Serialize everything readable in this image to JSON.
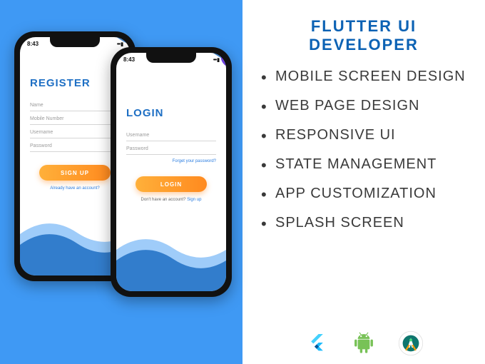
{
  "header": {
    "title": "FLUTTER UI DEVELOPER"
  },
  "bullets": [
    "Mobile screen design",
    "Web page design",
    "Responsive UI",
    "State management",
    "App customization",
    "Splash Screen"
  ],
  "phones": {
    "register": {
      "time": "8:43",
      "title": "REGISTER",
      "fields": [
        "Name",
        "Mobile Number",
        "Username",
        "Password"
      ],
      "button": "SIGN UP",
      "footer_text": "Already have an account?"
    },
    "login": {
      "time": "8:43",
      "title": "LOGIN",
      "fields": [
        "Username",
        "Password"
      ],
      "forgot": "Forget your password?",
      "button": "LOGIN",
      "footer_prefix": "Don't have an account? ",
      "footer_link": "Sign up"
    }
  },
  "logos": {
    "flutter": "flutter-logo",
    "android": "android-logo",
    "android_studio": "android-studio-logo"
  }
}
